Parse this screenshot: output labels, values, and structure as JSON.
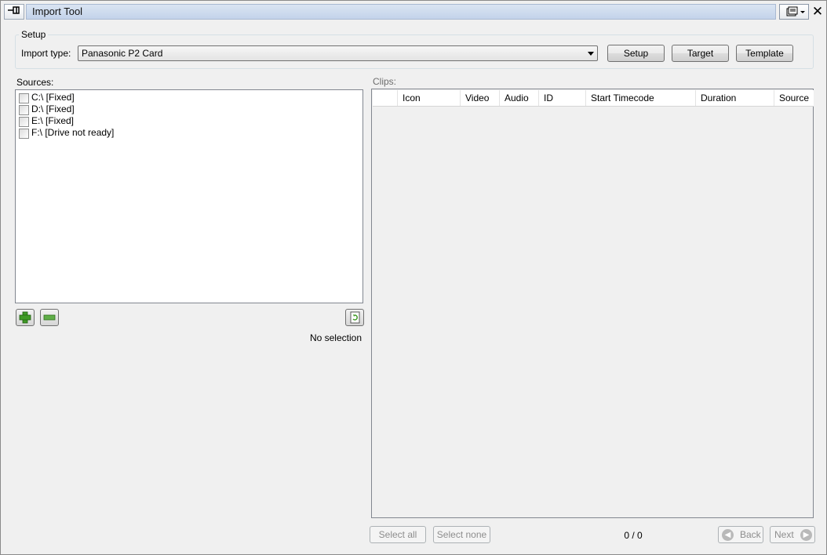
{
  "window": {
    "title": "Import Tool",
    "pin_icon": "pin-icon",
    "menu_icon": "window-menu-icon",
    "close_icon": "close-icon"
  },
  "setup": {
    "group_label": "Setup",
    "import_type_label": "Import type:",
    "import_type_value": "Panasonic P2 Card",
    "buttons": {
      "setup": "Setup",
      "target": "Target",
      "template": "Template"
    }
  },
  "sources": {
    "label": "Sources:",
    "items": [
      {
        "label": "C:\\ [Fixed]",
        "checked": false
      },
      {
        "label": "D:\\ [Fixed]",
        "checked": false
      },
      {
        "label": "E:\\ [Fixed]",
        "checked": false
      },
      {
        "label": "F:\\ [Drive not ready]",
        "checked": false
      }
    ],
    "add_icon": "plus-icon",
    "remove_icon": "minus-icon",
    "refresh_icon": "refresh-icon",
    "selection_status": "No selection"
  },
  "clips": {
    "label": "Clips:",
    "columns": [
      "",
      "Icon",
      "Video",
      "Audio",
      "ID",
      "Start Timecode",
      "Duration",
      "Source"
    ],
    "rows": []
  },
  "footer": {
    "select_all": "Select all",
    "select_none": "Select none",
    "counter": "0 / 0",
    "back": "Back",
    "next": "Next"
  },
  "colors": {
    "background": "#f0f0f0",
    "title_gradient_top": "#dae4f2",
    "title_gradient_bottom": "#c3d3ea",
    "disabled_text": "#8d8d8d",
    "add_green": "#3f9a25"
  }
}
